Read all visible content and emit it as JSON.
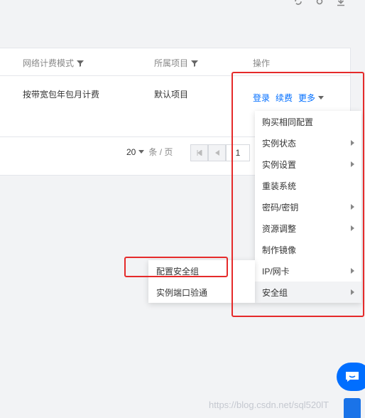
{
  "table": {
    "headers": {
      "network_billing": "网络计费模式",
      "project": "所属项目",
      "actions": "操作"
    },
    "row": {
      "network_billing": "按带宽包年包月计费",
      "project": "默认项目"
    },
    "links": {
      "login": "登录",
      "renew": "续费",
      "more": "更多"
    }
  },
  "pager": {
    "page_size": "20",
    "per_page_label": "条 / 页",
    "current_page": "1"
  },
  "menu": {
    "items": [
      {
        "label": "购买相同配置",
        "has_sub": false
      },
      {
        "label": "实例状态",
        "has_sub": true
      },
      {
        "label": "实例设置",
        "has_sub": true
      },
      {
        "label": "重装系统",
        "has_sub": false
      },
      {
        "label": "密码/密钥",
        "has_sub": true
      },
      {
        "label": "资源调整",
        "has_sub": true
      },
      {
        "label": "制作镜像",
        "has_sub": false
      },
      {
        "label": "IP/网卡",
        "has_sub": true
      },
      {
        "label": "安全组",
        "has_sub": true
      }
    ]
  },
  "submenu": {
    "items": [
      {
        "label": "配置安全组"
      },
      {
        "label": "实例端口验通"
      }
    ]
  },
  "watermark": "https://blog.csdn.net/sql520lT",
  "colors": {
    "link": "#006eff",
    "highlight": "#e52a2a",
    "background": "#f2f3f5"
  }
}
